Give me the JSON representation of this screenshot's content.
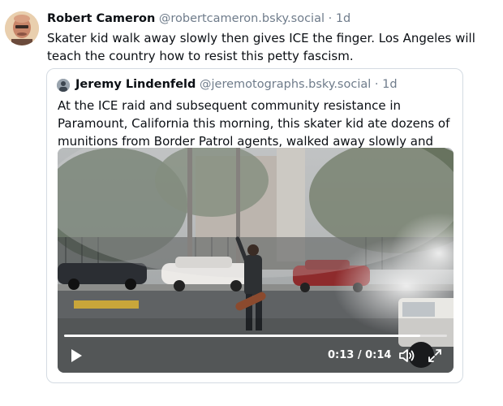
{
  "post": {
    "author_name": "Robert Cameron",
    "author_handle": "@robertcameron.bsky.social",
    "separator": "·",
    "timestamp": "1d",
    "text": "Skater kid walk away slowly then gives ICE the finger. Los Angeles will teach the country how to resist this petty fascism."
  },
  "quote": {
    "author_name": "Jeremy Lindenfeld",
    "author_handle": "@jeremotographs.bsky.social",
    "separator": "·",
    "timestamp": "1d",
    "text": "At the ICE raid and subsequent community resistance in Paramount, California this morning, this skater kid ate dozens of munitions from Border Patrol agents, walked away slowly and flipped them off."
  },
  "video": {
    "current_time": "0:13",
    "duration": "0:14",
    "time_display": "0:13 / 0:14",
    "progress_fraction": 0.93,
    "play_icon": "play-icon",
    "volume_icon": "volume-icon",
    "fullscreen_icon": "fullscreen-icon"
  },
  "colors": {
    "text": "#0b0f14",
    "muted": "#6f7c8b",
    "border": "#d4dbe2"
  }
}
